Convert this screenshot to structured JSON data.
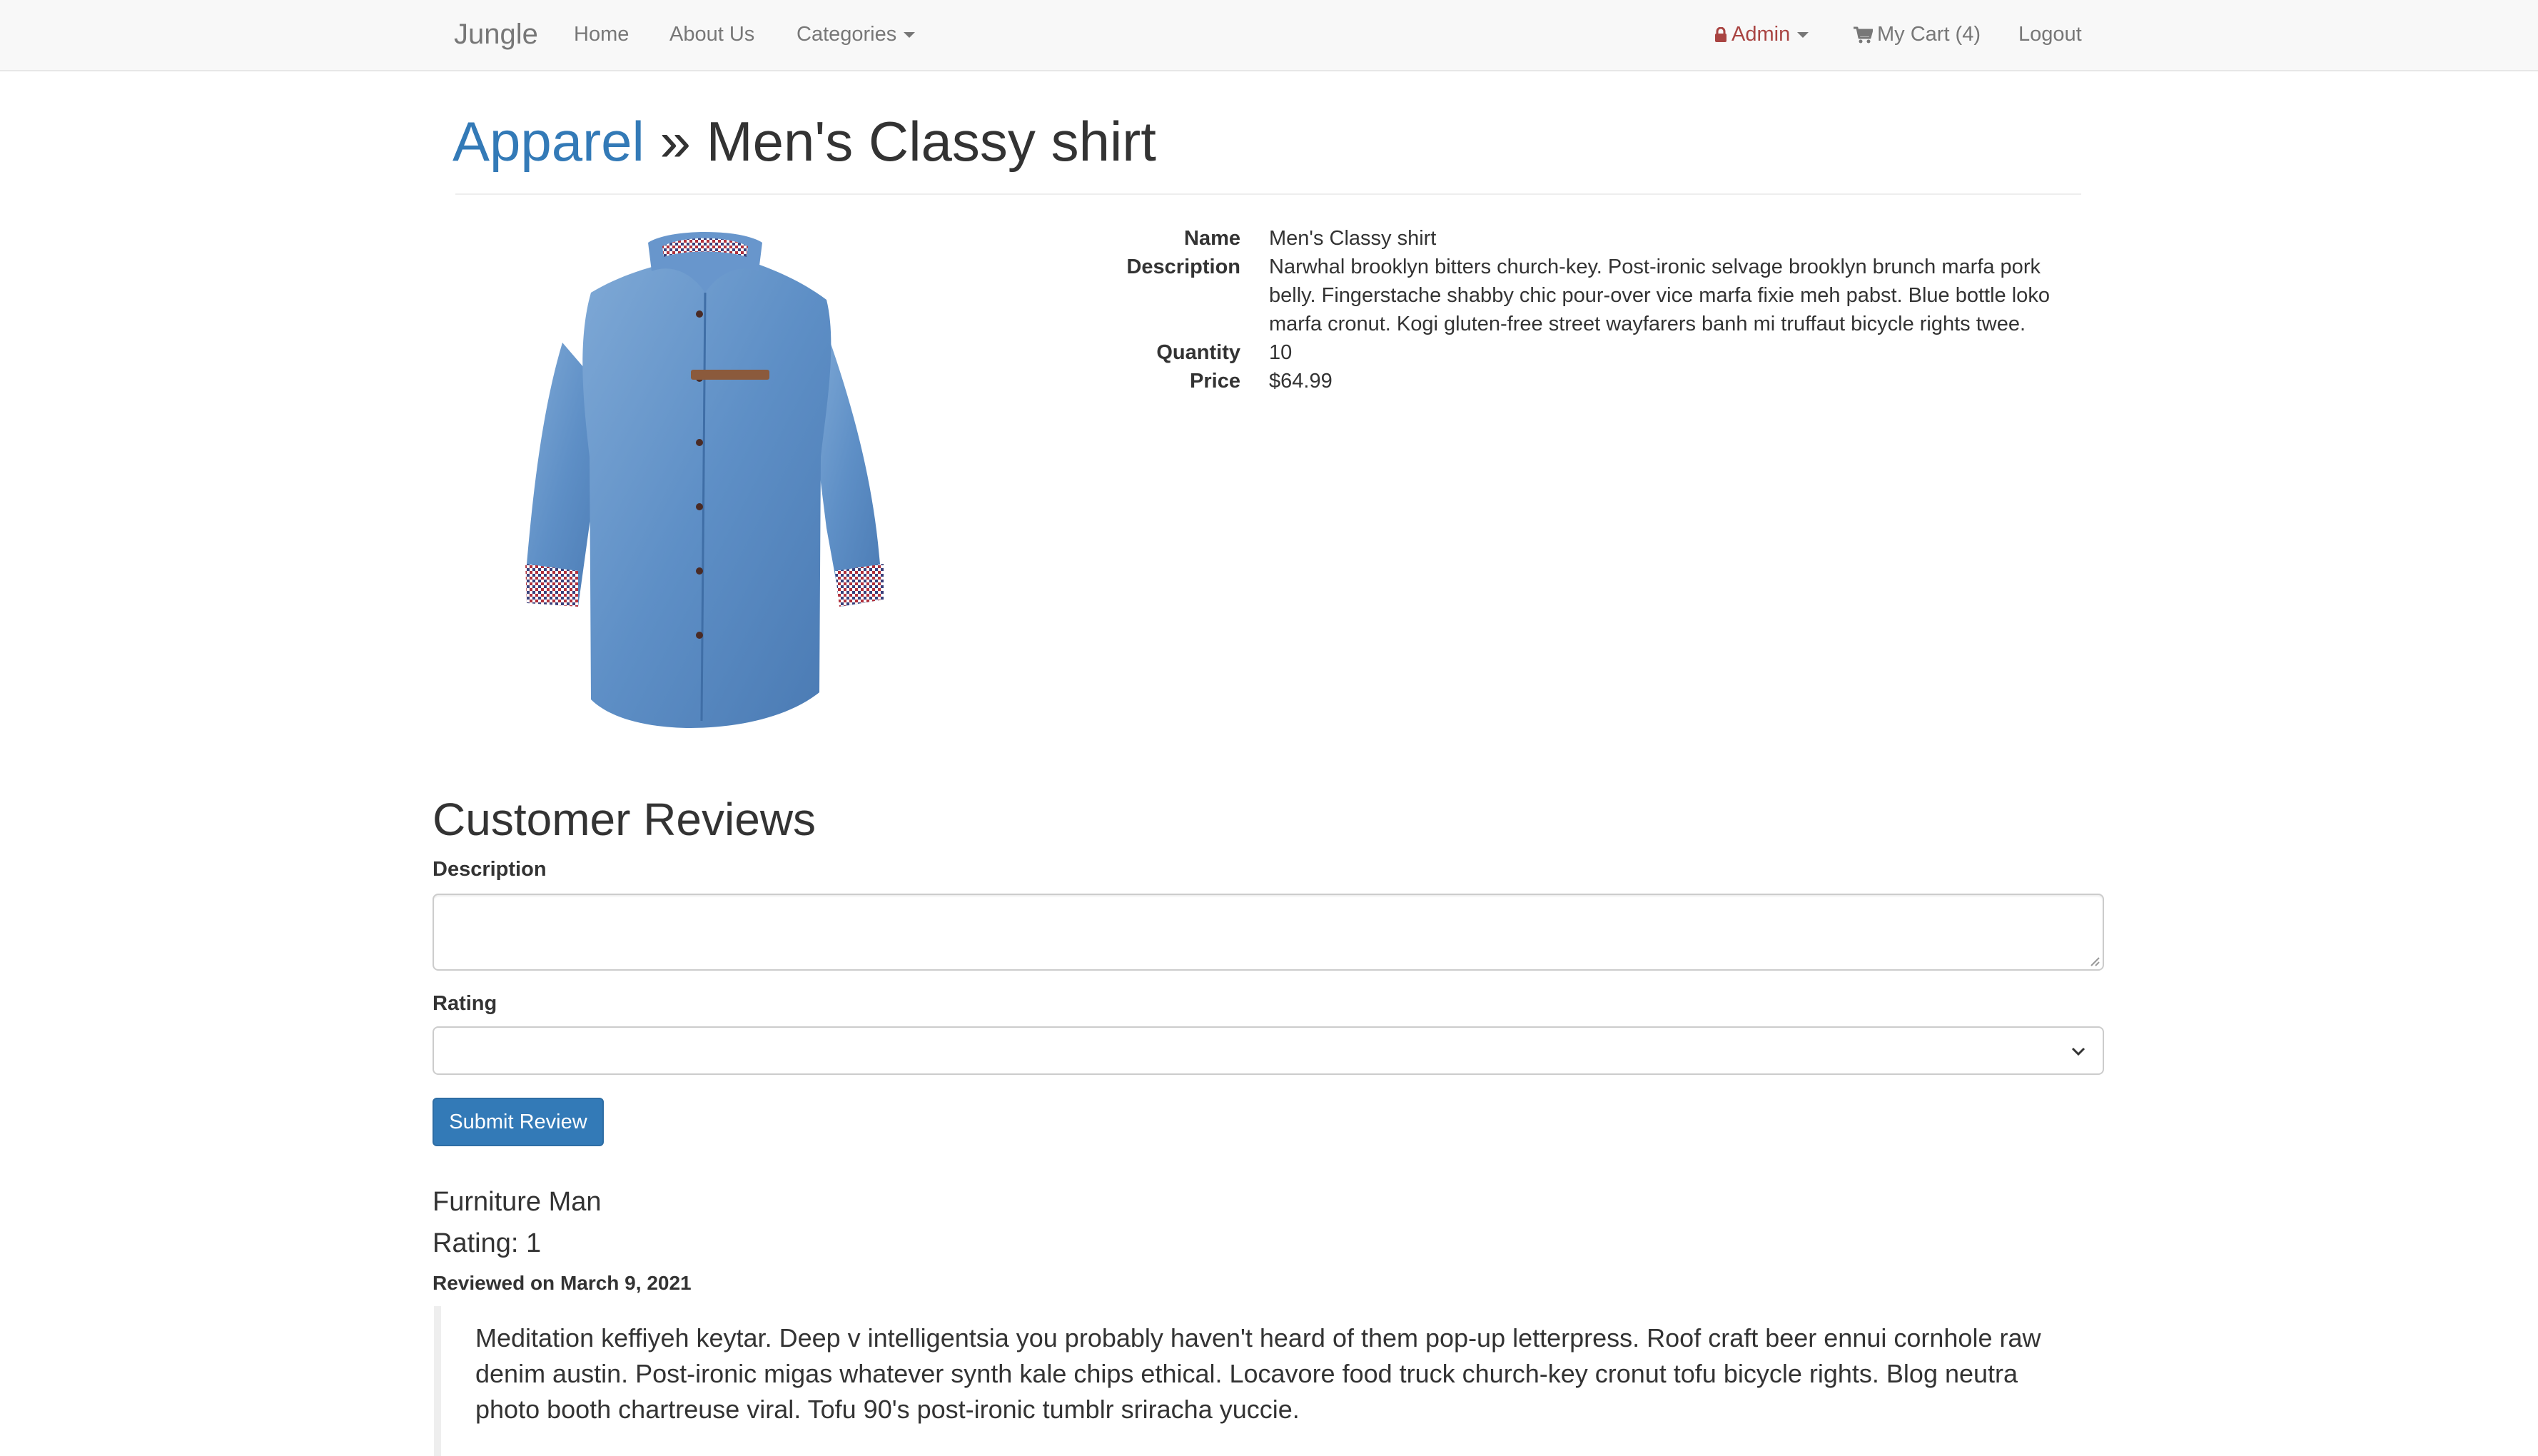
{
  "navbar": {
    "brand": "Jungle",
    "links": {
      "home": "Home",
      "about": "About Us",
      "categories": "Categories",
      "admin": "Admin",
      "cart": "My Cart (4)",
      "logout": "Logout"
    },
    "icons": {
      "admin": "lock-icon",
      "cart": "shopping-cart-icon"
    },
    "colors": {
      "admin_text": "#a94442",
      "link": "#777777"
    }
  },
  "product": {
    "category": "Apparel",
    "separator": "»",
    "title": "Men's Classy shirt",
    "image_alt": "blue denim shirt",
    "details": {
      "name_label": "Name",
      "name": "Men's Classy shirt",
      "description_label": "Description",
      "description": "Narwhal brooklyn bitters church-key. Post-ironic selvage brooklyn brunch marfa pork belly. Fingerstache shabby chic pour-over vice marfa fixie meh pabst. Blue bottle loko marfa cronut. Kogi gluten-free street wayfarers banh mi truffaut bicycle rights twee.",
      "quantity_label": "Quantity",
      "quantity": "10",
      "price_label": "Price",
      "price": "$64.99"
    }
  },
  "reviews": {
    "heading": "Customer Reviews",
    "form": {
      "description_label": "Description",
      "description_value": "",
      "rating_label": "Rating",
      "rating_value": "",
      "submit_label": "Submit Review"
    },
    "items": [
      {
        "author": "Furniture Man",
        "rating": "Rating: 1",
        "date": "Reviewed on March 9, 2021",
        "text": "Meditation keffiyeh keytar. Deep v intelligentsia you probably haven't heard of them pop-up letterpress. Roof craft beer ennui cornhole raw denim austin. Post-ironic migas whatever synth kale chips ethical. Locavore food truck church-key cronut tofu bicycle rights. Blog neutra photo booth chartreuse viral. Tofu 90's post-ironic tumblr sriracha yuccie."
      }
    ]
  },
  "colors": {
    "primary": "#337ab7",
    "navbar_bg": "#f8f8f8"
  }
}
